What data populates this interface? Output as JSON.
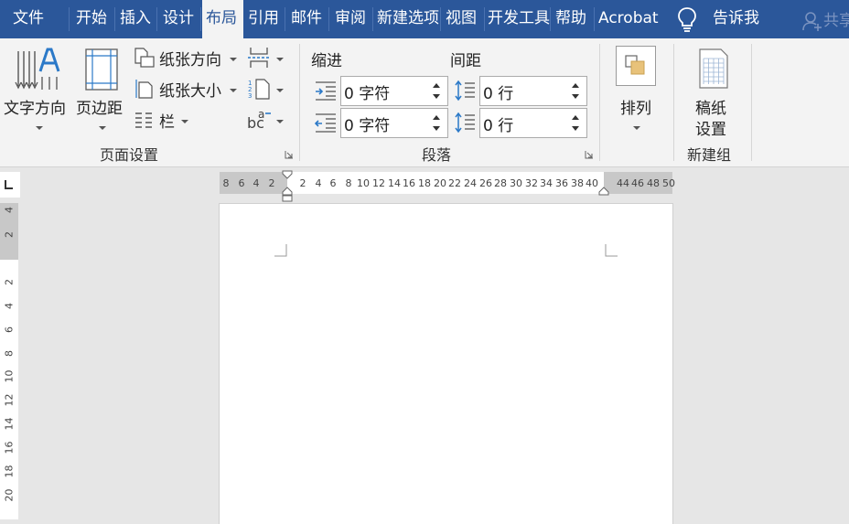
{
  "tabs": [
    {
      "label": "文件",
      "active": false
    },
    {
      "label": "开始",
      "active": false
    },
    {
      "label": "插入",
      "active": false
    },
    {
      "label": "设计",
      "active": false
    },
    {
      "label": "布局",
      "active": true
    },
    {
      "label": "引用",
      "active": false
    },
    {
      "label": "邮件",
      "active": false
    },
    {
      "label": "审阅",
      "active": false
    },
    {
      "label": "新建选项",
      "active": false
    },
    {
      "label": "视图",
      "active": false
    },
    {
      "label": "开发工具",
      "active": false
    },
    {
      "label": "帮助",
      "active": false
    },
    {
      "label": "Acrobat",
      "active": false
    }
  ],
  "tell_me": {
    "label": "告诉我",
    "icon": "lightbulb-icon"
  },
  "share": {
    "label": "共享",
    "icon": "person-add-icon"
  },
  "page_setup": {
    "text_direction": "文字方向",
    "margins": "页边距",
    "orientation": "纸张方向",
    "size": "纸张大小",
    "columns": "栏",
    "group_label": "页面设置"
  },
  "paragraph": {
    "indent_header": "缩进",
    "spacing_header": "间距",
    "indent_left": "0 字符",
    "indent_right": "0 字符",
    "spacing_before": "0 行",
    "spacing_after": "0 行",
    "group_label": "段落"
  },
  "arrange": {
    "label": "排列"
  },
  "newgroup": {
    "manuscript_line1": "稿纸",
    "manuscript_line2": "设置",
    "group_label": "新建组"
  },
  "hruler": {
    "labels": [
      "8",
      "6",
      "4",
      "2",
      "2",
      "4",
      "6",
      "8",
      "10",
      "12",
      "14",
      "16",
      "18",
      "20",
      "22",
      "24",
      "26",
      "28",
      "30",
      "32",
      "34",
      "36",
      "38",
      "40",
      "44",
      "46",
      "48",
      "50"
    ]
  },
  "vruler": {
    "labels": [
      "4",
      "2",
      "2",
      "4",
      "6",
      "8",
      "10",
      "12",
      "14",
      "16",
      "18",
      "20"
    ]
  },
  "colors": {
    "accent": "#2b579a",
    "ribbon": "#f3f3f3",
    "canvas": "#e6e6e6"
  }
}
